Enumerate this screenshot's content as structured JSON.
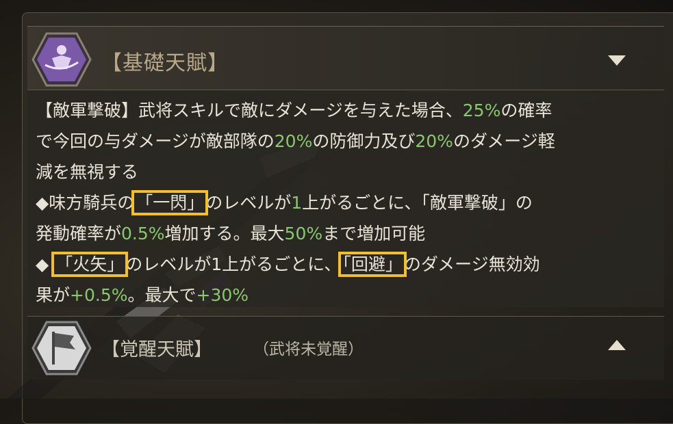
{
  "basic_talent": {
    "title": "【基礎天賦】",
    "emblem_icon": "purple-warrior-emblem",
    "toggle_icon": "chevron-down-icon",
    "line1": {
      "a": "【敵軍撃破】武将スキルで敵にダメージを与えた場合、",
      "v1": "25%",
      "b": "の確率"
    },
    "line2": {
      "a": "で今回の与ダメージが敵部隊の",
      "v1": "20%",
      "b": "の防御力及び",
      "v2": "20%",
      "c": "のダメージ軽"
    },
    "line3": {
      "a": "減を無視する"
    },
    "line4": {
      "a": "◆味方騎兵の",
      "h1": "「一閃」",
      "b": "のレベルが",
      "v1": "1",
      "c": "上がるごとに、「敵軍撃破」の"
    },
    "line5": {
      "a": "発動確率が",
      "v1": "0.5%",
      "b": "増加する。最大",
      "v2": "50%",
      "c": "まで増加可能"
    },
    "line6": {
      "a": "◆ ",
      "h1": "「火矢」",
      "b": "のレベルが1上がるごとに、",
      "h2": "「回避」",
      "c": "のダメージ無効効"
    },
    "line7": {
      "a": "果が",
      "v1": "+0.5%",
      "b": "。最大で",
      "v2": "+30%"
    }
  },
  "awakening_talent": {
    "title": "【覚醒天賦】",
    "subtitle": "（武将未覚醒）",
    "emblem_icon": "flag-emblem",
    "toggle_icon": "chevron-up-icon"
  },
  "colors": {
    "value_green": "#8ac870",
    "highlight": "#f0c030"
  }
}
